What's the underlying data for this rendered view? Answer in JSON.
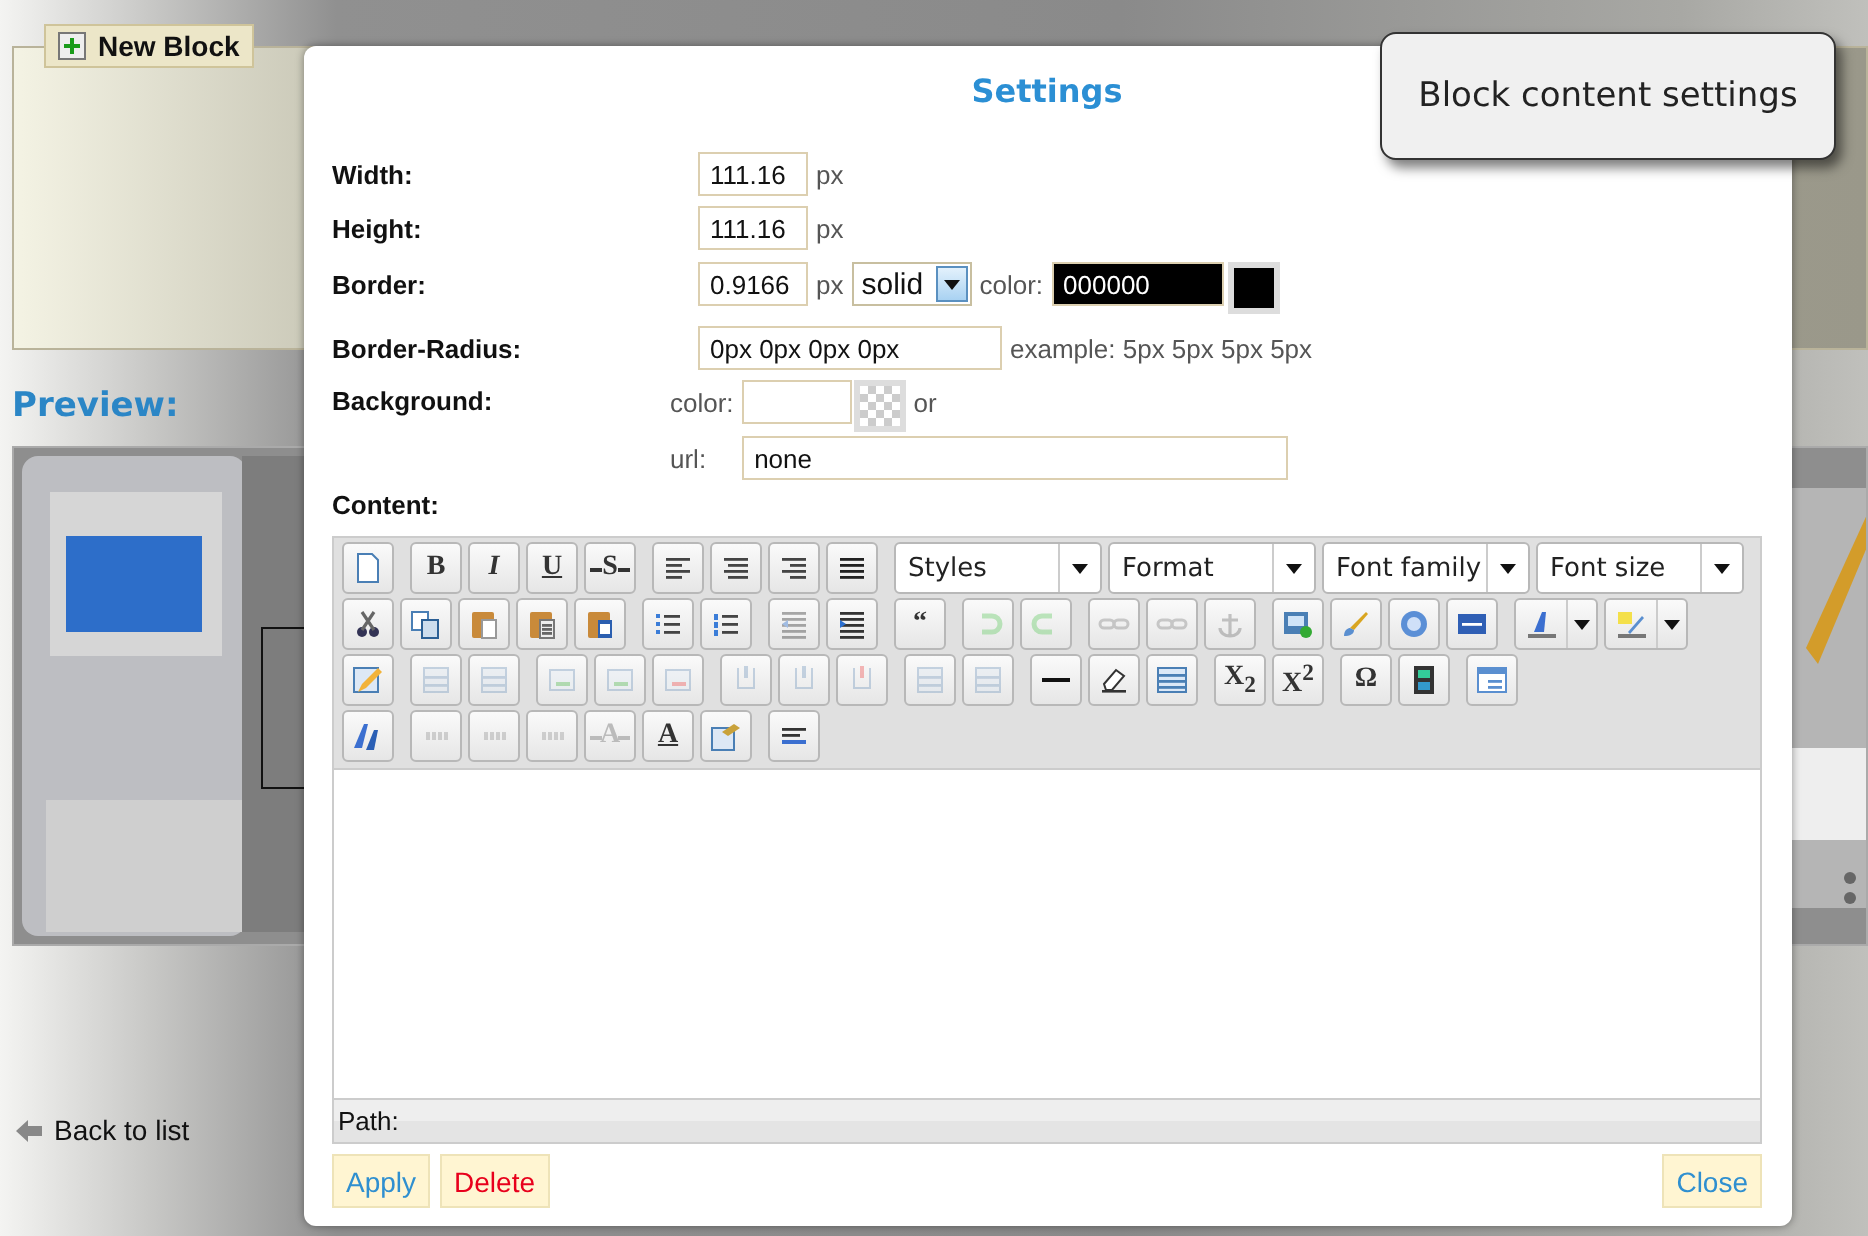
{
  "page": {
    "new_block": "New Block",
    "preview_heading": "Preview:",
    "back_link": "Back to list"
  },
  "tooltip": "Block content settings",
  "dialog": {
    "title": "Settings",
    "width": {
      "label": "Width:",
      "value": "111.16",
      "unit": "px"
    },
    "height": {
      "label": "Height:",
      "value": "111.16",
      "unit": "px"
    },
    "border": {
      "label": "Border:",
      "value": "0.9166",
      "unit": "px",
      "style": "solid",
      "color_label": "color:",
      "color_value": "000000",
      "color": "#000000"
    },
    "border_radius": {
      "label": "Border-Radius:",
      "value": "0px 0px 0px 0px",
      "hint": "example: 5px 5px 5px 5px"
    },
    "background": {
      "label": "Background:",
      "color_label": "color:",
      "or": "or",
      "url_label": "url:",
      "url_value": "none"
    },
    "content_label": "Content:",
    "toolbar": [
      [
        [
          {
            "kind": "icon",
            "disabled": false
          }
        ],
        [
          {
            "kind": "bold",
            "text": "B",
            "disabled": false
          },
          {
            "kind": "italic",
            "text": "I",
            "disabled": false
          },
          {
            "kind": "underline",
            "text": "U",
            "disabled": false
          },
          {
            "kind": "strike",
            "text": "S",
            "disabled": false
          }
        ],
        [
          {
            "kind": "icon",
            "disabled": false
          },
          {
            "kind": "icon",
            "disabled": false
          },
          {
            "kind": "icon",
            "disabled": false
          },
          {
            "kind": "icon",
            "disabled": false
          }
        ],
        [
          {
            "kind": "dropdown",
            "label": "Styles"
          },
          {
            "kind": "dropdown",
            "label": "Format"
          },
          {
            "kind": "dropdown",
            "label": "Font family"
          },
          {
            "kind": "dropdown",
            "label": "Font size"
          }
        ]
      ],
      [
        [
          {
            "kind": "icon",
            "disabled": false
          },
          {
            "kind": "icon",
            "disabled": false
          },
          {
            "kind": "icon",
            "disabled": false
          },
          {
            "kind": "icon",
            "disabled": false
          },
          {
            "kind": "icon",
            "disabled": false
          }
        ],
        [
          {
            "kind": "icon",
            "disabled": false
          },
          {
            "kind": "icon",
            "disabled": false
          }
        ],
        [
          {
            "kind": "icon",
            "disabled": true
          },
          {
            "kind": "icon",
            "disabled": false
          }
        ],
        [
          {
            "kind": "bold",
            "text": "“",
            "disabled": false
          }
        ],
        [
          {
            "kind": "icon",
            "disabled": true
          },
          {
            "kind": "icon",
            "disabled": true
          }
        ],
        [
          {
            "kind": "icon",
            "disabled": true
          },
          {
            "kind": "icon",
            "disabled": true
          },
          {
            "kind": "icon",
            "disabled": true
          }
        ],
        [
          {
            "kind": "icon",
            "disabled": false
          },
          {
            "kind": "icon",
            "disabled": false
          },
          {
            "kind": "icon",
            "disabled": false
          },
          {
            "kind": "icon",
            "disabled": false
          }
        ],
        [
          {
            "kind": "split",
            "disabled": false
          },
          {
            "kind": "split",
            "disabled": false
          }
        ]
      ],
      [
        [
          {
            "kind": "icon",
            "disabled": false
          }
        ],
        [
          {
            "kind": "icon",
            "disabled": true
          },
          {
            "kind": "icon",
            "disabled": true
          }
        ],
        [
          {
            "kind": "icon",
            "disabled": true
          },
          {
            "kind": "icon",
            "disabled": true
          },
          {
            "kind": "icon",
            "disabled": true
          }
        ],
        [
          {
            "kind": "icon",
            "disabled": true
          },
          {
            "kind": "icon",
            "disabled": true
          },
          {
            "kind": "icon",
            "disabled": true
          }
        ],
        [
          {
            "kind": "icon",
            "disabled": true
          },
          {
            "kind": "icon",
            "disabled": true
          }
        ],
        [
          {
            "kind": "icon",
            "disabled": false
          },
          {
            "kind": "icon",
            "disabled": false
          },
          {
            "kind": "icon",
            "disabled": false
          }
        ],
        [
          {
            "kind": "bold",
            "text": "X$_{2}$",
            "disabled": false
          },
          {
            "kind": "bold",
            "text": "X$^{2}$",
            "disabled": false
          }
        ],
        [
          {
            "kind": "plain",
            "text": "Ω",
            "disabled": false
          },
          {
            "kind": "icon",
            "disabled": false
          }
        ],
        [
          {
            "kind": "icon",
            "disabled": false
          }
        ]
      ],
      [
        [
          {
            "kind": "icon",
            "disabled": false
          }
        ],
        [
          {
            "kind": "icon",
            "disabled": true
          },
          {
            "kind": "icon",
            "disabled": true
          },
          {
            "kind": "icon",
            "disabled": true
          },
          {
            "kind": "strike",
            "text": "A",
            "disabled": true
          },
          {
            "kind": "underline",
            "text": "A",
            "disabled": false
          },
          {
            "kind": "icon",
            "disabled": false
          }
        ],
        [
          {
            "kind": "icon",
            "disabled": false
          }
        ]
      ]
    ],
    "path_label": "Path:",
    "buttons": [
      {
        "label": "Apply",
        "kind": "apply"
      },
      {
        "label": "Delete",
        "kind": "delete"
      },
      {
        "label": "Close",
        "kind": "close"
      }
    ]
  }
}
